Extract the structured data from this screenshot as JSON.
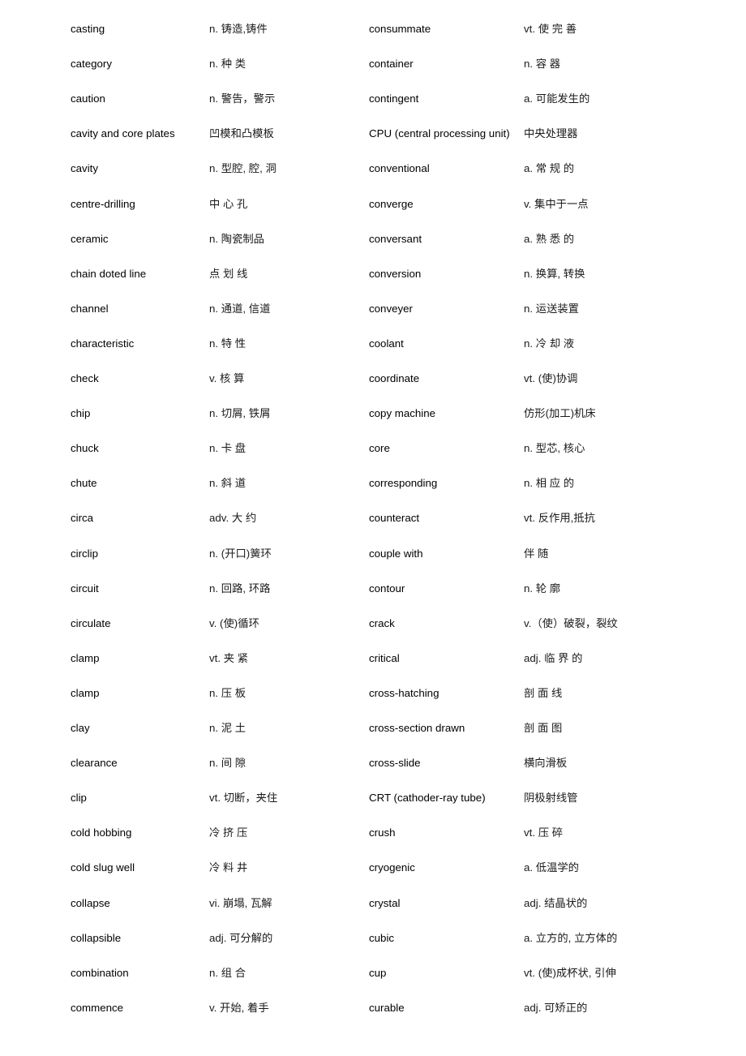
{
  "glossary": {
    "rows": [
      {
        "left_term": "casting",
        "left_def": "n. 铸造,铸件",
        "right_term": "consummate",
        "right_def": "vt. 使 完 善"
      },
      {
        "left_term": "category",
        "left_def": "n. 种 类",
        "right_term": "container",
        "right_def": "n. 容 器"
      },
      {
        "left_term": "caution",
        "left_def": "n. 警告，警示",
        "right_term": "contingent",
        "right_def": "a. 可能发生的"
      },
      {
        "left_term": "cavity and core plates",
        "left_def": "凹模和凸模板",
        "right_term": "CPU (central processing unit)",
        "right_def": "中央处理器"
      },
      {
        "left_term": "cavity",
        "left_def": "n. 型腔, 腔, 洞",
        "right_term": "conventional",
        "right_def": "a. 常 规 的"
      },
      {
        "left_term": "centre-drilling",
        "left_def": "中 心 孔",
        "right_term": "converge",
        "right_def": "v. 集中于一点"
      },
      {
        "left_term": "ceramic",
        "left_def": "n. 陶瓷制品",
        "right_term": "conversant",
        "right_def": "a. 熟 悉 的"
      },
      {
        "left_term": "chain doted line",
        "left_def": "点 划 线",
        "right_term": "conversion",
        "right_def": "n. 换算, 转换"
      },
      {
        "left_term": "channel",
        "left_def": "n. 通道, 信道",
        "right_term": "conveyer",
        "right_def": "n. 运送装置"
      },
      {
        "left_term": "characteristic",
        "left_def": "n. 特 性",
        "right_term": "coolant",
        "right_def": "n. 冷 却 液"
      },
      {
        "left_term": "check",
        "left_def": "v. 核 算",
        "right_term": "coordinate",
        "right_def": "vt. (使)协调"
      },
      {
        "left_term": "chip",
        "left_def": "n. 切屑, 铁屑",
        "right_term": "copy machine",
        "right_def": "仿形(加工)机床"
      },
      {
        "left_term": "chuck",
        "left_def": "n. 卡 盘",
        "right_term": "core",
        "right_def": "n. 型芯, 核心"
      },
      {
        "left_term": "chute",
        "left_def": "n. 斜 道",
        "right_term": "corresponding",
        "right_def": "n. 相 应 的"
      },
      {
        "left_term": "circa",
        "left_def": "adv. 大 约",
        "right_term": "counteract",
        "right_def": "vt. 反作用,抵抗"
      },
      {
        "left_term": "circlip",
        "left_def": "n. (开口)簧环",
        "right_term": "couple with",
        "right_def": "伴 随"
      },
      {
        "left_term": "circuit",
        "left_def": "n. 回路, 环路",
        "right_term": "contour",
        "right_def": "n. 轮 廓"
      },
      {
        "left_term": "circulate",
        "left_def": "v. (使)循环",
        "right_term": "crack",
        "right_def": "v.（使）破裂，裂纹"
      },
      {
        "left_term": "clamp",
        "left_def": "vt. 夹 紧",
        "right_term": "critical",
        "right_def": "adj. 临 界 的"
      },
      {
        "left_term": "clamp",
        "left_def": "n. 压 板",
        "right_term": "cross-hatching",
        "right_def": "剖 面 线"
      },
      {
        "left_term": "clay",
        "left_def": "n. 泥 土",
        "right_term": "cross-section drawn",
        "right_def": "剖 面 图"
      },
      {
        "left_term": "clearance",
        "left_def": "n. 间 隙",
        "right_term": "cross-slide",
        "right_def": "横向滑板"
      },
      {
        "left_term": "clip",
        "left_def": "vt. 切断，夹住",
        "right_term": "CRT (cathoder-ray tube)",
        "right_def": "阴极射线管"
      },
      {
        "left_term": "cold hobbing",
        "left_def": "冷 挤 压",
        "right_term": "crush",
        "right_def": "vt. 压 碎"
      },
      {
        "left_term": "cold slug well",
        "left_def": "冷 料 井",
        "right_term": "cryogenic",
        "right_def": "a. 低温学的"
      },
      {
        "left_term": "collapse",
        "left_def": "vi. 崩塌, 瓦解",
        "right_term": "crystal",
        "right_def": "adj. 结晶状的"
      },
      {
        "left_term": "collapsible",
        "left_def": "adj. 可分解的",
        "right_term": "cubic",
        "right_def": "a. 立方的, 立方体的"
      },
      {
        "left_term": "combination",
        "left_def": "n. 组 合",
        "right_term": "cup",
        "right_def": "vt. (使)成杯状, 引伸"
      },
      {
        "left_term": "commence",
        "left_def": "v. 开始, 着手",
        "right_term": "curable",
        "right_def": "adj. 可矫正的"
      }
    ]
  }
}
